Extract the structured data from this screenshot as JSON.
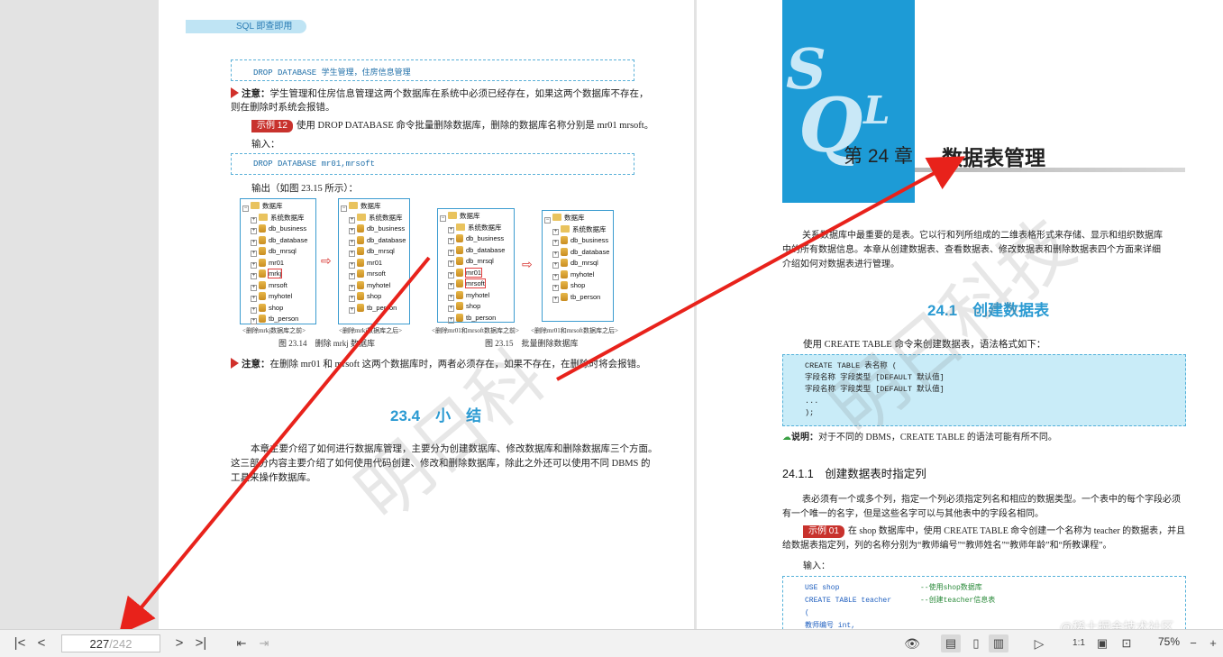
{
  "left_page": {
    "running_head": "SQL 即查即用",
    "code1": "DROP DATABASE 学生管理，住房信息管理",
    "note1_label": "注意：",
    "note1_text": "学生管理和住房信息管理这两个数据库在系统中必须已经存在，如果这两个数据库不存在，",
    "note1_text2": "则在删除时系统会报错。",
    "example_badge": "示例 12",
    "example_text": "使用 DROP DATABASE 命令批量删除数据库，删除的数据库名称分别是 mr01 mrsoft。",
    "input_label": "输入：",
    "code2": "DROP DATABASE mr01,mrsoft",
    "output_label": "输出（如图 23.15 所示）：",
    "tree_root": "数据库",
    "tree_system": "系统数据库",
    "tree1": [
      "db_business",
      "db_database",
      "db_mrsql",
      "mr01",
      "mrkj",
      "mrsoft",
      "myhotel",
      "shop",
      "tb_person"
    ],
    "tree2": [
      "db_business",
      "db_database",
      "db_mrsql",
      "mr01",
      "mrsoft",
      "myhotel",
      "shop",
      "tb_person"
    ],
    "tree3": [
      "db_business",
      "db_database",
      "db_mrsql",
      "mr01",
      "mrsoft",
      "myhotel",
      "shop",
      "tb_person"
    ],
    "tree4": [
      "db_business",
      "db_database",
      "db_mrsql",
      "myhotel",
      "shop",
      "tb_person"
    ],
    "cap1": "<删除mrkj数据库之前>",
    "cap2": "<删除mrkj数据库之后>",
    "cap3": "<删除mr01和mrsoft数据库之前>",
    "cap4": "<删除mr01和mrsoft数据库之后>",
    "fig1": "图 23.14　删除 mrkj 数据库",
    "fig2": "图 23.15　批量删除数据库",
    "note2_label": "注意：",
    "note2_text": "在删除 mr01 和 mrsoft 这两个数据库时，两者必须存在，如果不存在，在删除时将会报错。",
    "section_title": "23.4　小　结",
    "summary1": "本章主要介绍了如何进行数据库管理，主要分为创建数据库、修改数据库和删除数据库三个方面。",
    "summary2": "这三部分内容主要介绍了如何使用代码创建、修改和删除数据库，除此之外还可以使用不同 DBMS 的",
    "summary3": "工具来操作数据库。"
  },
  "right_page": {
    "logo_letters": [
      "S",
      "Q",
      "L"
    ],
    "chapter_label": "第 24 章",
    "chapter_title": "数据表管理",
    "intro1": "关系数据库中最重要的是表。它以行和列所组成的二维表格形式来存储、显示和组织数据库",
    "intro2": "中的所有数据信息。本章从创建数据表、查看数据表、修改数据表和删除数据表四个方面来详细",
    "intro3": "介绍如何对数据表进行管理。",
    "section_title": "24.1　创建数据表",
    "syntax_intro": "使用 CREATE TABLE 命令来创建数据表，语法格式如下：",
    "syntax_lines": [
      "CREATE TABLE 表名称 (",
      "字段名称 字段类型 [DEFAULT 默认值]",
      "字段名称 字段类型 [DEFAULT 默认值]",
      "...",
      ");"
    ],
    "tip_label": "说明：",
    "tip_text": "对于不同的 DBMS，CREATE TABLE 的语法可能有所不同。",
    "subsection": "24.1.1　创建数据表时指定列",
    "para1": "表必须有一个或多个列，指定一个列必须指定列名和相应的数据类型。一个表中的每个字段必须",
    "para2": "有一个唯一的名字，但是这些名字可以与其他表中的字段名相同。",
    "example_badge": "示例 01",
    "example_text": "在 shop 数据库中，使用 CREATE TABLE 命令创建一个名称为 teacher 的数据表，并且",
    "example_text2": "给数据表指定列，列的名称分别为“教师编号”“教师姓名”“教师年龄”和“所教课程”。",
    "input_label": "输入：",
    "code": [
      {
        "a": "USE shop",
        "b": "--使用shop数据库"
      },
      {
        "a": "CREATE  TABLE teacher",
        "b": "--创建teacher信息表"
      },
      {
        "a": "(",
        "b": ""
      },
      {
        "a": "  教师编号  int,",
        "b": ""
      }
    ]
  },
  "toolbar": {
    "current_page": "227",
    "total_pages": "/242",
    "zoom": "75%",
    "watermark": "@稀土掘金技术社区"
  }
}
